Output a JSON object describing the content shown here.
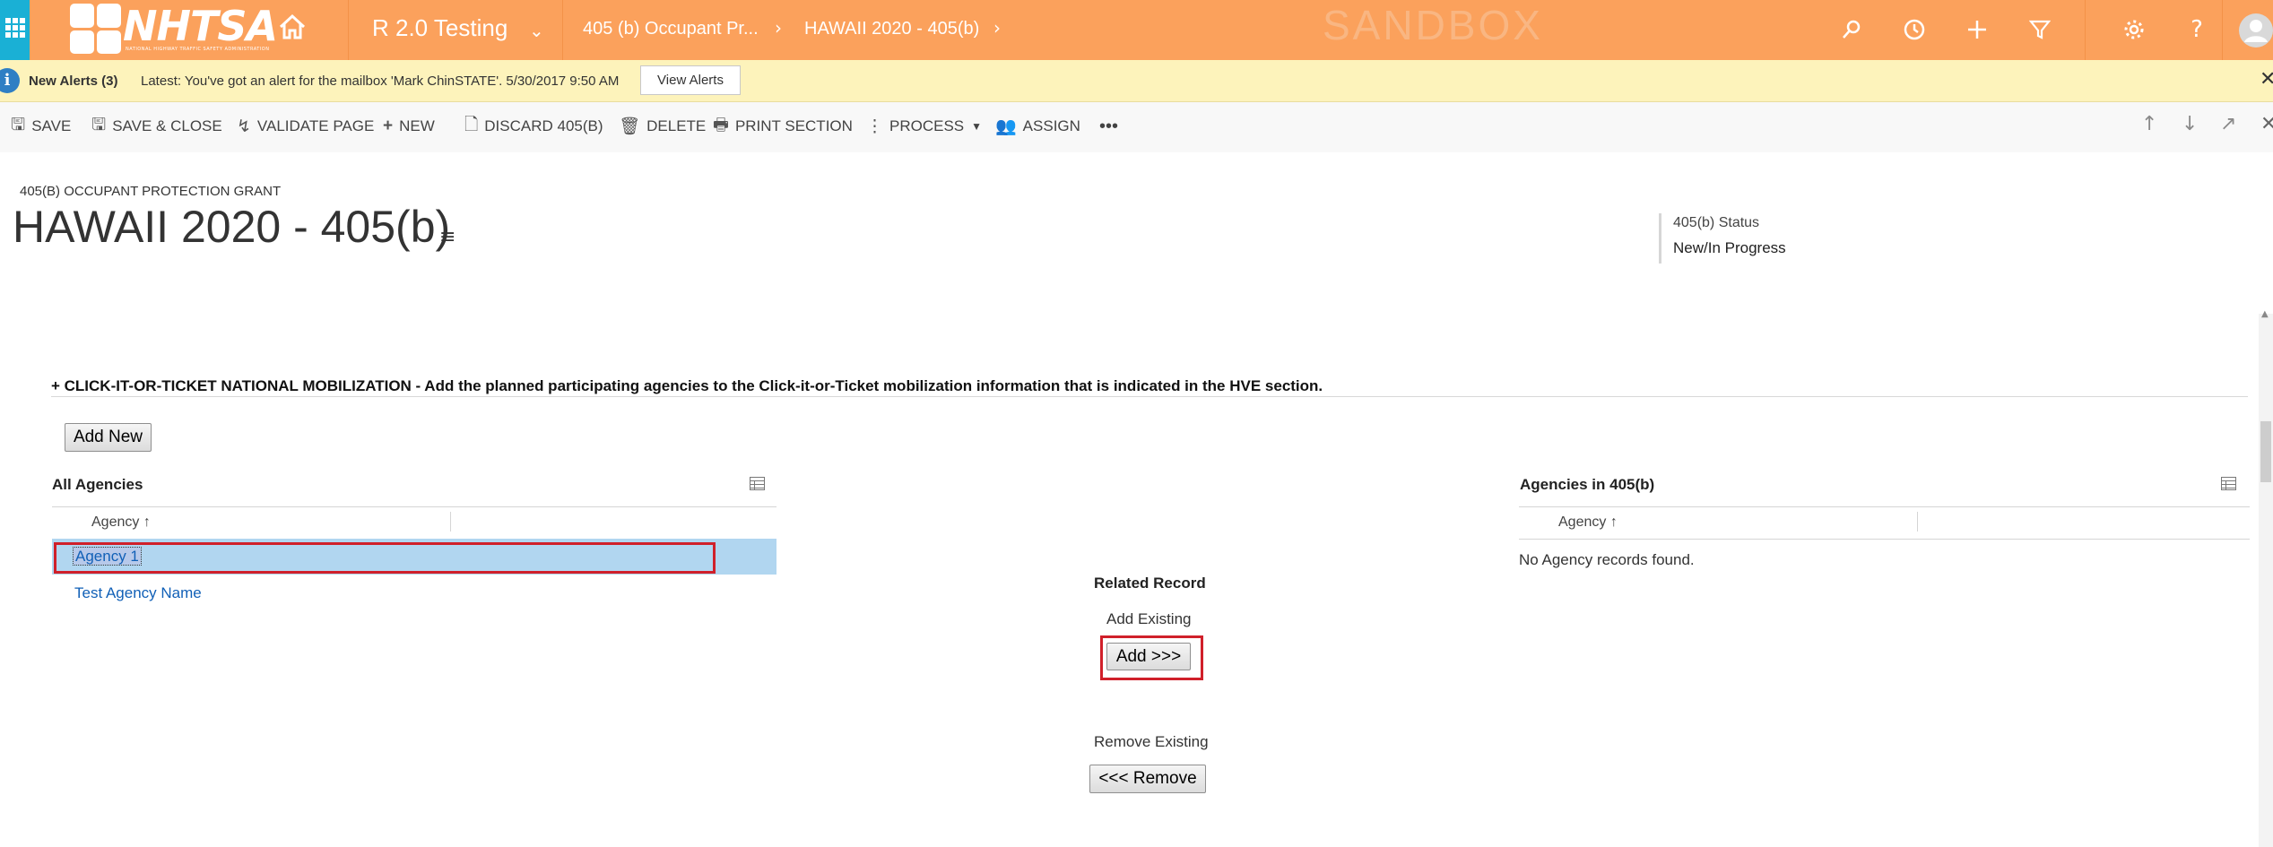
{
  "nav": {
    "logo_text": "NHTSA",
    "logo_subtitle": "NATIONAL HIGHWAY TRAFFIC SAFETY ADMINISTRATION",
    "app_name": "R 2.0 Testing",
    "breadcrumb": [
      "405 (b) Occupant Pr...",
      "HAWAII 2020 - 405(b)"
    ],
    "environment": "SANDBOX",
    "icons": [
      "waffle-icon",
      "home-icon",
      "search-icon",
      "history-icon",
      "plus-icon",
      "filter-icon",
      "gear-icon",
      "help-icon",
      "user-avatar-icon"
    ]
  },
  "alerts": {
    "title": "New Alerts (3)",
    "message": "Latest: You've got an alert for the mailbox 'Mark ChinSTATE'. 5/30/2017 9:50 AM",
    "view_button": "View Alerts"
  },
  "toolbar": {
    "save": "SAVE",
    "save_close": "SAVE & CLOSE",
    "validate": "VALIDATE PAGE",
    "new": "NEW",
    "discard": "DISCARD 405(B)",
    "delete": "DELETE",
    "print": "PRINT SECTION",
    "process": "PROCESS",
    "assign": "ASSIGN",
    "more": "•••"
  },
  "header": {
    "entity_type": "405(B) OCCUPANT PROTECTION GRANT",
    "title": "HAWAII 2020 - 405(b)",
    "status_label": "405(b) Status",
    "status_value": "New/In Progress"
  },
  "section": {
    "title": "+ CLICK-IT-OR-TICKET NATIONAL MOBILIZATION - Add the planned participating agencies to the Click-it-or-Ticket mobilization information that is indicated in the HVE section.",
    "add_new_button": "Add New"
  },
  "all_agencies": {
    "title": "All Agencies",
    "column_header": "Agency ↑",
    "rows": [
      "Agency 1",
      "Test Agency Name"
    ]
  },
  "related": {
    "title": "Related Record",
    "add_existing_label": "Add Existing",
    "add_button": "Add >>>",
    "remove_existing_label": "Remove Existing",
    "remove_button": "<<< Remove"
  },
  "agencies_405b": {
    "title": "Agencies in 405(b)",
    "column_header": "Agency ↑",
    "empty_message": "No Agency records found."
  },
  "colors": {
    "nav_bg": "#fba15c",
    "waffle_bg": "#1ab0d5",
    "alert_bg": "#fdf3bb",
    "link": "#1160b7",
    "highlight_box": "#d0202a",
    "selected_row": "#b1d6f0"
  }
}
